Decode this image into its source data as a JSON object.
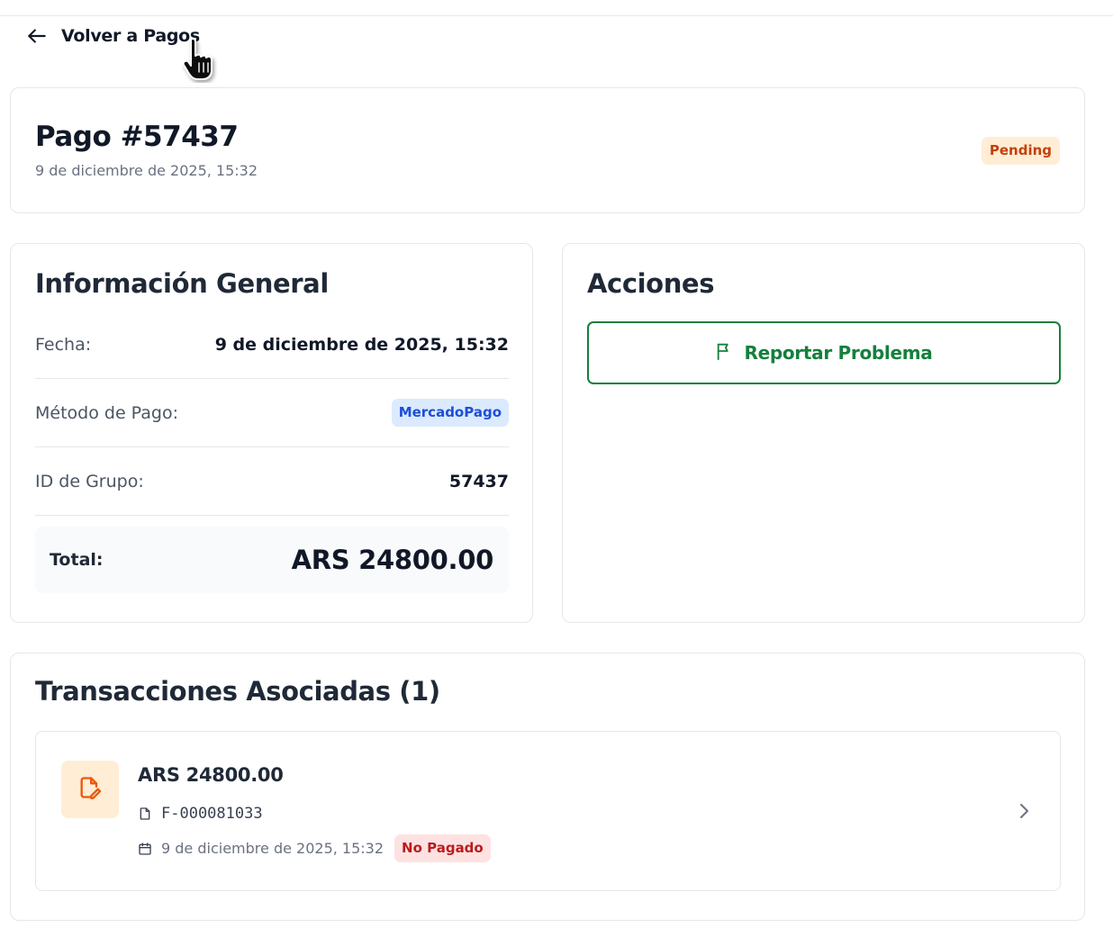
{
  "nav": {
    "back_label": "Volver a Pagos"
  },
  "header": {
    "title": "Pago #57437",
    "date": "9 de diciembre de 2025, 15:32",
    "status": "Pending"
  },
  "info": {
    "title": "Información General",
    "rows": [
      {
        "label": "Fecha:",
        "value": "9 de diciembre de 2025, 15:32"
      },
      {
        "label": "Método de Pago:",
        "value": "MercadoPago"
      },
      {
        "label": "ID de Grupo:",
        "value": "57437"
      }
    ],
    "total_label": "Total:",
    "total_value": "ARS 24800.00"
  },
  "actions": {
    "title": "Acciones",
    "report_label": "Reportar Problema"
  },
  "transactions": {
    "title": "Transacciones Asociadas (1)",
    "items": [
      {
        "amount": "ARS 24800.00",
        "invoice": "F-000081033",
        "date": "9 de diciembre de 2025, 15:32",
        "status": "No Pagado"
      }
    ]
  },
  "colors": {
    "accent_green": "#15803d",
    "pending_bg": "#ffedd5",
    "pending_text": "#c2410c",
    "method_bg": "#dbeafe",
    "method_text": "#1d4ed8",
    "unpaid_bg": "#fee2e2",
    "unpaid_text": "#b91c1c"
  },
  "icons": [
    "arrow-left-icon",
    "flag-icon",
    "file-edit-icon",
    "file-icon",
    "calendar-icon",
    "chevron-right-icon",
    "hand-pointer-cursor"
  ]
}
